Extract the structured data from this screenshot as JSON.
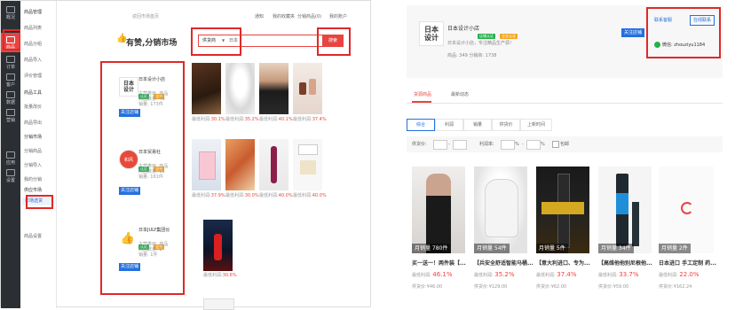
{
  "sidebar": {
    "items": [
      {
        "label": "概况",
        "icon": "dashboard-icon"
      },
      {
        "label": "商品",
        "icon": "goods-icon"
      },
      {
        "label": "订单",
        "icon": "order-icon"
      },
      {
        "label": "客户",
        "icon": "customer-icon"
      },
      {
        "label": "数据",
        "icon": "data-icon"
      },
      {
        "label": "营销",
        "icon": "marketing-icon"
      },
      {
        "label": "应用",
        "icon": "apps-icon"
      },
      {
        "label": "设置",
        "icon": "settings-icon"
      }
    ]
  },
  "menu2": {
    "groups": [
      {
        "title": "商品管理",
        "items": [
          "商品列表",
          "商品分组",
          "商品导入",
          "评价管理"
        ]
      },
      {
        "title": "商品工具",
        "items": [
          "批量改价",
          "商品导出"
        ]
      },
      {
        "title": "分销市场",
        "items": [
          "供货商列表",
          "分销商品",
          "分销导入",
          "我的分销"
        ]
      },
      {
        "title": "供应市场",
        "items": [
          "市场选货"
        ]
      },
      {
        "title": "",
        "items": [
          "商品设置"
        ]
      }
    ],
    "active_item": "市场选货"
  },
  "top": {
    "breadcrumb": "返回市场首页",
    "links": [
      "通知",
      "我的收藏夹",
      "分销商品(0)",
      "我的账户"
    ]
  },
  "market": {
    "logo_text": "有赞,分销市场",
    "search": {
      "type": "供货商",
      "placeholder": "日本",
      "button": "搜索"
    }
  },
  "suppliers": [
    {
      "name": "日本设计小店",
      "logo": "日本\n设计",
      "stats": [
        "主营类目: 商品",
        "商品数量: 49",
        "销量: 173件"
      ],
      "follow": "关注店铺",
      "products": [
        {
          "label": "最低利润:",
          "value": "30.1%"
        },
        {
          "label": "最低利润:",
          "value": "35.2%"
        },
        {
          "label": "最低利润:",
          "value": "40.1%"
        },
        {
          "label": "最低利润:",
          "value": "37.4%"
        }
      ]
    },
    {
      "name": "日本贸易社",
      "logo": "和风",
      "stats": [
        "主营类目: 商品",
        "商品数量: 11",
        "销量: 161件"
      ],
      "follow": "关注店铺",
      "products": [
        {
          "label": "最低利润:",
          "value": "37.9%"
        },
        {
          "label": "最低利润:",
          "value": "30.0%"
        },
        {
          "label": "最低利润:",
          "value": "40.0%"
        },
        {
          "label": "最低利润:",
          "value": "40.0%"
        }
      ]
    },
    {
      "name": "日本JULY集团仪",
      "logo": "👍",
      "stats": [
        "主营类目: 商品",
        "商品数量: 1",
        "销量: 1件"
      ],
      "follow": "关注店铺",
      "products": [
        {
          "label": "最低利润:",
          "value": "30.6%"
        }
      ]
    }
  ],
  "store": {
    "logo": "日本\n设计",
    "name": "日本设计小店",
    "tags": [
      "店铺认证",
      "企业认证"
    ],
    "desc": "日本设计小店，专注精品生产源！",
    "stats": "商品: 349   分销商: 1738",
    "follow": "关注店铺",
    "contact": {
      "title": "联系客服",
      "online": "在线联系",
      "wechat_label": "微信:",
      "wechat": "zhouziyu1184"
    },
    "tabs": [
      "货源商品",
      "最新动态"
    ],
    "sort": [
      "综合",
      "利润",
      "销量",
      "供货价",
      "上新时间"
    ],
    "filters": {
      "price_label": "供货价:",
      "profit_label": "利润率:",
      "unit": "%",
      "checkbox": "包邮"
    },
    "products": [
      {
        "title": "买一送一！两件装【...",
        "sales": "月销量 780件",
        "profit_label": "最低利润:",
        "profit": "46.1%",
        "supply_label": "供货价:",
        "supply": "¥46.00"
      },
      {
        "title": "【兵安全舒适智能马桶...",
        "sales": "月销量 54件",
        "profit_label": "最低利润:",
        "profit": "35.2%",
        "supply_label": "供货价:",
        "supply": "¥129.00"
      },
      {
        "title": "【意大利进口、专为...",
        "sales": "月销量 5件",
        "profit_label": "最低利润:",
        "profit": "37.4%",
        "supply_label": "供货价:",
        "supply": "¥62.00"
      },
      {
        "title": "【高维他他别尼根他...",
        "sales": "月销量 34件",
        "profit_label": "最低利润:",
        "profit": "33.7%",
        "supply_label": "供货价:",
        "supply": "¥59.00"
      },
      {
        "title": "日本进口 手工定制 药...",
        "sales": "月销量 2件",
        "profit_label": "最低利润:",
        "profit": "22.0%",
        "supply_label": "供货价:",
        "supply": "¥162.24"
      }
    ]
  },
  "colors": {
    "accent": "#e94440",
    "blue": "#2470e0",
    "sidebar": "#2b2f33",
    "green": "#23b24b",
    "orange": "#f5a623",
    "highlight": "#e02828"
  }
}
